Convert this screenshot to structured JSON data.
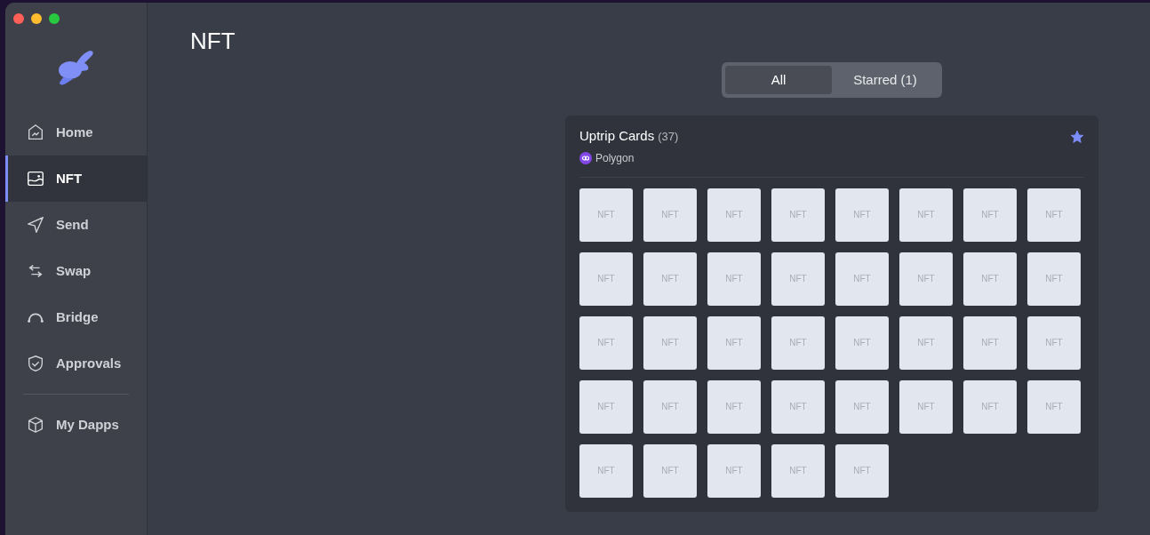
{
  "window": {
    "traffic_lights": true
  },
  "sidebar": {
    "items": [
      {
        "label": "Home",
        "selected": false
      },
      {
        "label": "NFT",
        "selected": true
      },
      {
        "label": "Send",
        "selected": false
      },
      {
        "label": "Swap",
        "selected": false
      },
      {
        "label": "Bridge",
        "selected": false
      },
      {
        "label": "Approvals",
        "selected": false
      }
    ],
    "secondary_items": [
      {
        "label": "My Dapps",
        "selected": false
      }
    ]
  },
  "page": {
    "title": "NFT"
  },
  "tabs": [
    {
      "label": "All",
      "selected": true
    },
    {
      "label": "Starred (1)",
      "selected": false
    }
  ],
  "collection": {
    "name": "Uptrip Cards",
    "count": "(37)",
    "chain": "Polygon",
    "starred": true,
    "items": [
      "NFT",
      "NFT",
      "NFT",
      "NFT",
      "NFT",
      "NFT",
      "NFT",
      "NFT",
      "NFT",
      "NFT",
      "NFT",
      "NFT",
      "NFT",
      "NFT",
      "NFT",
      "NFT",
      "NFT",
      "NFT",
      "NFT",
      "NFT",
      "NFT",
      "NFT",
      "NFT",
      "NFT",
      "NFT",
      "NFT",
      "NFT",
      "NFT",
      "NFT",
      "NFT",
      "NFT",
      "NFT",
      "NFT",
      "NFT",
      "NFT",
      "NFT",
      "NFT"
    ]
  }
}
